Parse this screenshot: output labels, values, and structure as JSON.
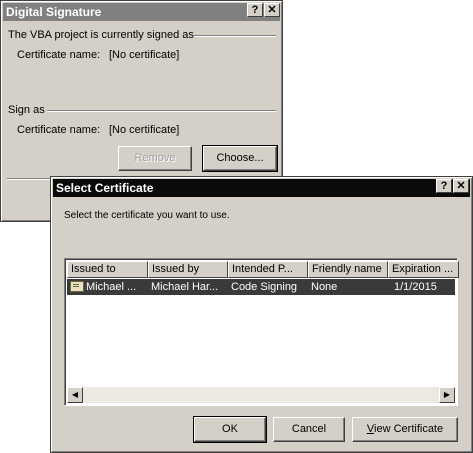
{
  "digital_signature": {
    "title": "Digital Signature",
    "help_glyph": "?",
    "close_glyph": "✕",
    "signed_heading": "The VBA project is currently signed as",
    "signed_cert_label": "Certificate name:",
    "signed_cert_value": "[No certificate]",
    "sign_as_heading": "Sign as",
    "sign_as_cert_label": "Certificate name:",
    "sign_as_cert_value": "[No certificate]",
    "remove_label": "Remove",
    "choose_label": "Choose..."
  },
  "select_certificate": {
    "title": "Select Certificate",
    "help_glyph": "?",
    "close_glyph": "✕",
    "instruction": "Select the certificate you want to use.",
    "columns": [
      "Issued to",
      "Issued by",
      "Intended P...",
      "Friendly name",
      "Expiration ..."
    ],
    "rows": [
      {
        "issued_to": "Michael ...",
        "issued_by": "Michael Har...",
        "intended_purpose": "Code Signing",
        "friendly_name": "None",
        "expiration": "1/1/2015",
        "icon": "certificate-icon"
      }
    ],
    "ok_label": "OK",
    "cancel_label": "Cancel",
    "view_cert_label_first": "V",
    "view_cert_label_rest": "iew Certificate"
  }
}
